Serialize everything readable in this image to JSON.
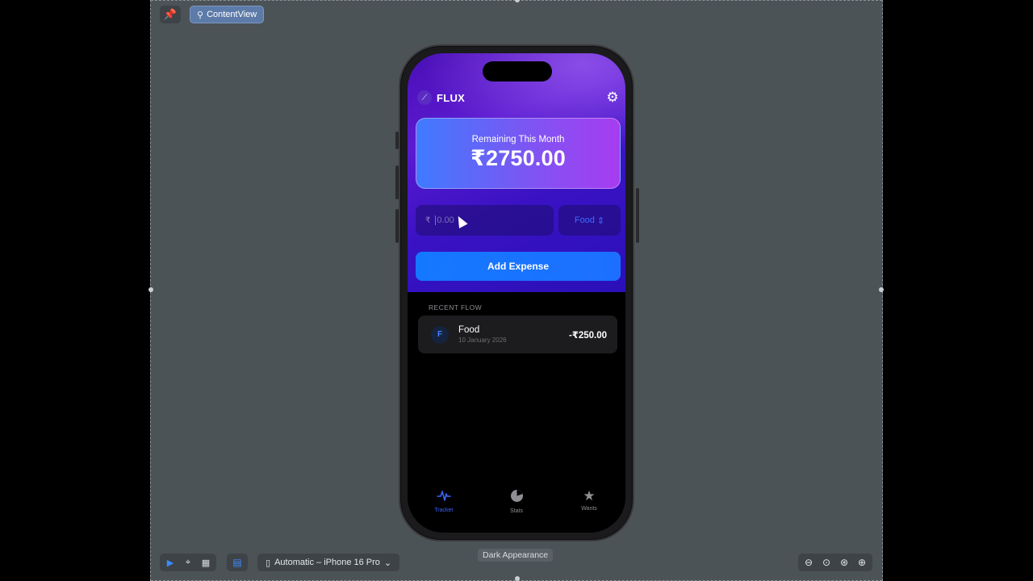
{
  "editor": {
    "preview_label": "ContentView",
    "device_selector": "Automatic – iPhone 16 Pro",
    "appearance_label": "Dark Appearance"
  },
  "app": {
    "brand": "FLUX",
    "balance": {
      "label": "Remaining This Month",
      "value": "₹2750.00"
    },
    "amount_input": {
      "currency_symbol": "₹",
      "placeholder": "0.00",
      "value": ""
    },
    "category_picker": {
      "selected": "Food"
    },
    "add_button_label": "Add Expense",
    "recent_section_title": "RECENT FLOW",
    "transactions": [
      {
        "badge": "F",
        "category": "Food",
        "date": "10 January 2026",
        "amount": "-₹250.00"
      }
    ],
    "tabs": [
      {
        "label": "Tracker",
        "icon": "waveform-icon",
        "active": true
      },
      {
        "label": "Stats",
        "icon": "pie-chart-icon",
        "active": false
      },
      {
        "label": "Wants",
        "icon": "star-icon",
        "active": false
      }
    ]
  },
  "colors": {
    "accent_blue": "#1478ff",
    "gradient_purple": "#5b1ad0",
    "card_gradient_start": "#3f7bff",
    "card_gradient_end": "#a73cf0",
    "active_tab": "#3a63ff"
  }
}
